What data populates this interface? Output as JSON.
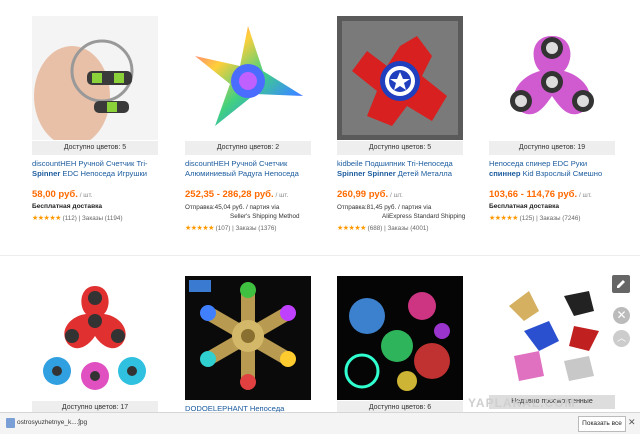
{
  "products": [
    {
      "colors": "Доступно цветов: 5",
      "title_plain": "discountНЕН Ручной Счетчик Tri-",
      "title_bold": "Spinner",
      "title_rest": " EDC Непоседа Игрушки",
      "price": "58,00 руб.",
      "unit": " / шт.",
      "shipping": "Бесплатная доставка",
      "shipping_method": "",
      "stars": "★★★★★",
      "rating": "(112)  |  Заказы (1194)"
    },
    {
      "colors": "Доступно цветов: 2",
      "title_plain": "discountНЕН Ручной Счетчик",
      "title_bold": "",
      "title_rest": "Алюминиевый Радуга Непоседа",
      "price": "252,35 - 286,28 руб.",
      "unit": " / шт.",
      "shipping": "Отправка:45,04 руб. / партия via",
      "shipping_method": "Seller's Shipping Method",
      "stars": "★★★★★",
      "rating": "(107)  |  Заказы (1376)"
    },
    {
      "colors": "Доступно цветов: 5",
      "title_plain": "kidbeile Подшипник Tri-Непоседа",
      "title_bold": "Spinner Spinner",
      "title_rest": " Детей Металла",
      "price": "260,99 руб.",
      "unit": " / шт.",
      "shipping": "Отправка:81,45 руб. / партия via",
      "shipping_method": "AliExpress Standard Shipping",
      "stars": "★★★★★",
      "rating": "(688)  |  Заказы (4001)"
    },
    {
      "colors": "Доступно цветов: 19",
      "title_plain": "Непоседа спинер EDC Руки",
      "title_bold": "спиннер",
      "title_rest": " Kid Взрослый Смешно",
      "price": "103,66 - 114,76 руб.",
      "unit": " / шт.",
      "shipping": "Бесплатная доставка",
      "shipping_method": "",
      "stars": "★★★★★",
      "rating": "(125)  |  Заказы (7246)"
    }
  ],
  "row2": [
    {
      "colors": "Доступно цветов: 17",
      "title": ""
    },
    {
      "colors": "",
      "title": "DODOELEPHANT Непоседа"
    },
    {
      "colors": "Доступно цветов: 6",
      "title": ""
    },
    {
      "colors": "Недавно просмотренные",
      "title": ""
    }
  ],
  "overlay": {
    "edit_icon": "pencil-icon",
    "close_label": "✕",
    "up_label": "︿",
    "watermark": "YAPLAKAL.COM"
  },
  "download_bar": {
    "file_name": "ostrosyuzhetnye_k....jpg",
    "arrow": "^",
    "show_all": "Показать все",
    "close": "✕"
  },
  "colors": {
    "price": "#ff6a00",
    "link": "#1b5b9e",
    "stars": "#ff9900"
  }
}
